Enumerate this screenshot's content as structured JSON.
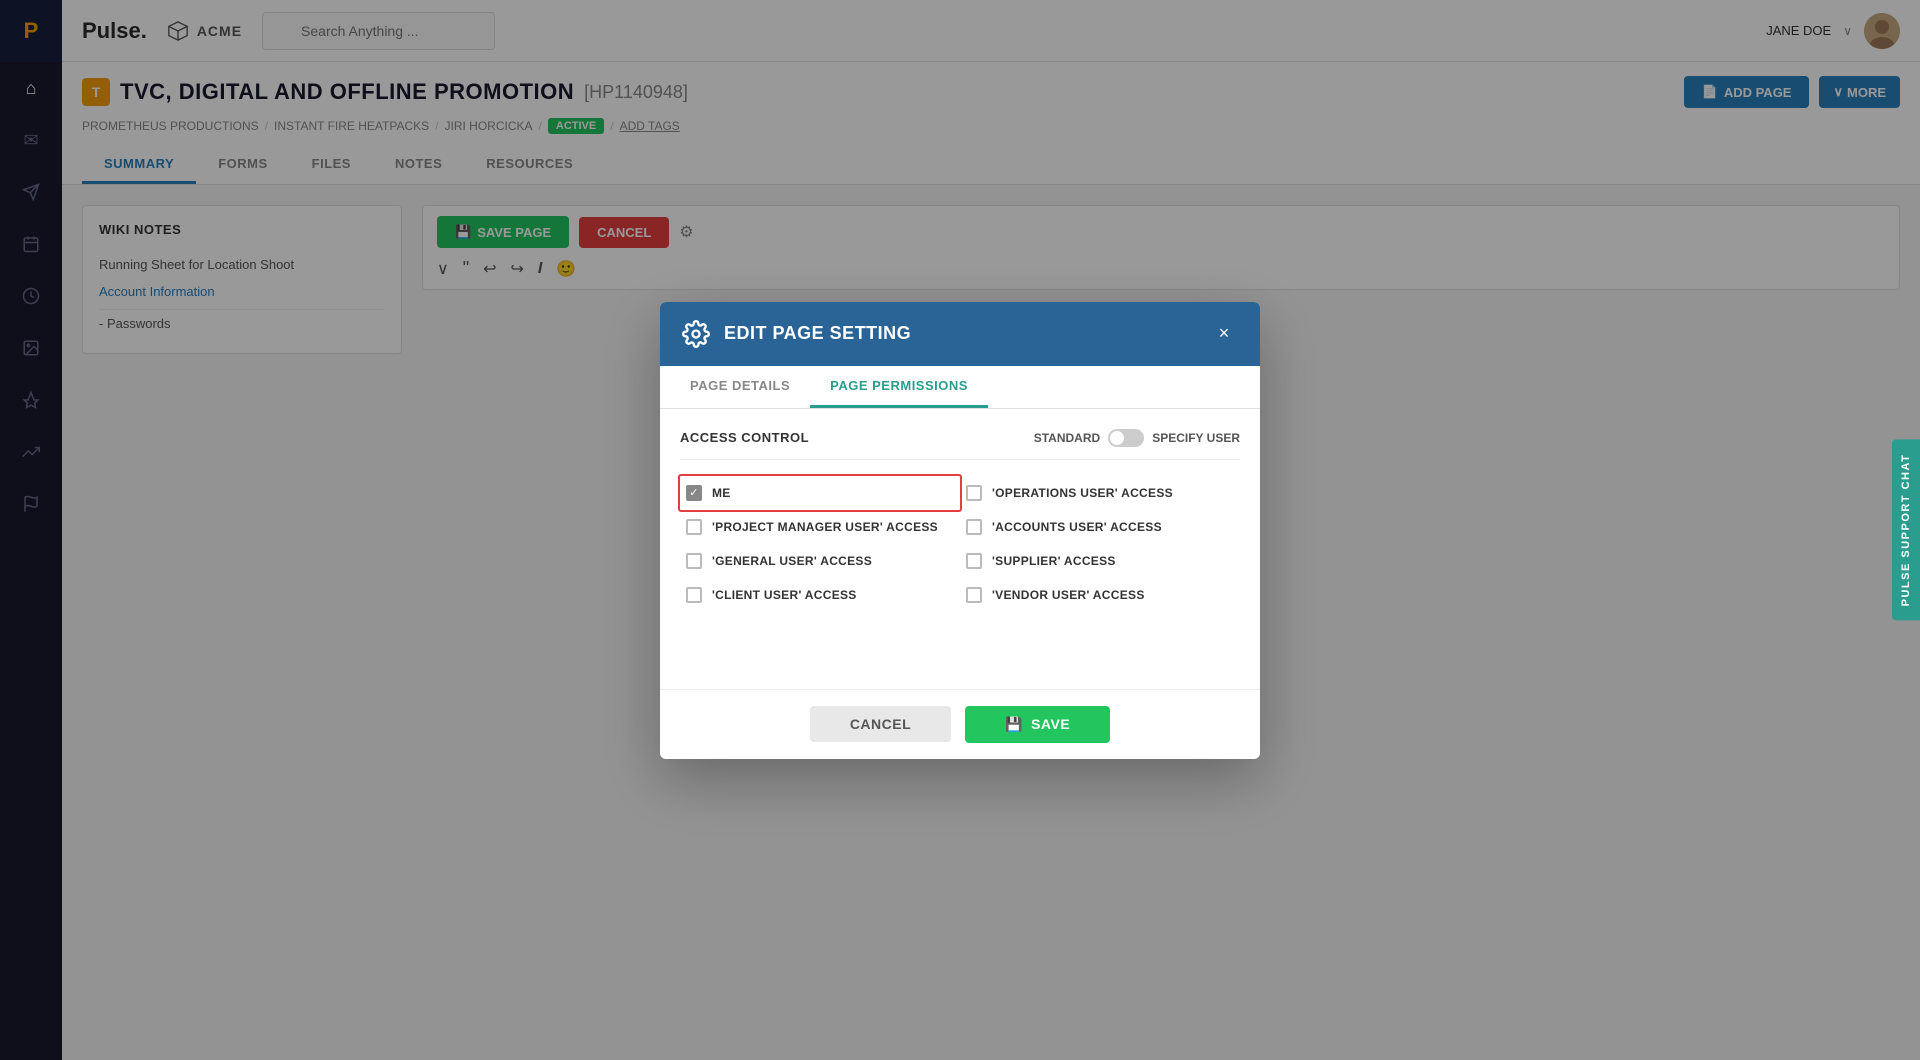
{
  "sidebar": {
    "icons": [
      {
        "name": "home-icon",
        "symbol": "⌂"
      },
      {
        "name": "mail-icon",
        "symbol": "✉"
      },
      {
        "name": "paper-plane-icon",
        "symbol": "✈"
      },
      {
        "name": "calendar-icon",
        "symbol": "📅"
      },
      {
        "name": "clock-icon",
        "symbol": "⏰"
      },
      {
        "name": "image-icon",
        "symbol": "🖼"
      },
      {
        "name": "rocket-icon",
        "symbol": "🚀"
      },
      {
        "name": "chart-icon",
        "symbol": "📊"
      },
      {
        "name": "send-icon",
        "symbol": "➤"
      }
    ]
  },
  "topnav": {
    "logo_text": "Pulse.",
    "acme_label": "ACME",
    "search_placeholder": "Search Anything ...",
    "user_name": "JANE DOE",
    "user_chevron": "∨"
  },
  "page_header": {
    "title": "TVC, DIGITAL AND OFFLINE PROMOTION",
    "project_id": "[HP1140948]",
    "breadcrumbs": [
      "PROMETHEUS PRODUCTIONS",
      "INSTANT FIRE HEATPACKS",
      "JIRI HORCICKA"
    ],
    "status_label": "ACTIVE",
    "add_tags_label": "ADD TAGS",
    "btn_add_page": "ADD PAGE",
    "btn_more": "MORE"
  },
  "tabs": [
    {
      "label": "SUMMARY",
      "active": true
    },
    {
      "label": "FORMS",
      "active": false
    },
    {
      "label": "FILES",
      "active": false
    },
    {
      "label": "NOTES",
      "active": false
    },
    {
      "label": "RESOURCES",
      "active": false
    }
  ],
  "wiki_notes": {
    "title": "WIKI NOTES",
    "link_label": "Account Information",
    "items": [
      "Running Sheet for Location Shoot",
      "- Passwords"
    ]
  },
  "toolbar": {
    "save_page_label": "SAVE PAGE",
    "cancel_label": "CANCEL"
  },
  "modal": {
    "title": "EDIT PAGE SETTING",
    "close_label": "×",
    "tabs": [
      {
        "label": "PAGE DETAILS",
        "active": false
      },
      {
        "label": "PAGE PERMISSIONS",
        "active": true
      }
    ],
    "access_control_label": "ACCESS CONTROL",
    "toggle_standard": "STANDARD",
    "toggle_specify": "SPECIFY USER",
    "permissions_left": [
      {
        "label": "ME",
        "checked": true,
        "highlighted": true
      },
      {
        "label": "'PROJECT MANAGER USER' ACCESS",
        "checked": false,
        "highlighted": false
      },
      {
        "label": "'GENERAL USER' ACCESS",
        "checked": false,
        "highlighted": false
      },
      {
        "label": "'CLIENT USER' ACCESS",
        "checked": false,
        "highlighted": false
      }
    ],
    "permissions_right": [
      {
        "label": "'OPERATIONS USER' ACCESS",
        "checked": false
      },
      {
        "label": "'ACCOUNTS USER' ACCESS",
        "checked": false
      },
      {
        "label": "'SUPPLIER' ACCESS",
        "checked": false
      },
      {
        "label": "'VENDOR USER' ACCESS",
        "checked": false
      }
    ],
    "cancel_label": "CANCEL",
    "save_label": "SAVE"
  },
  "support_chat": {
    "label": "PULSE SUPPORT CHAT"
  }
}
